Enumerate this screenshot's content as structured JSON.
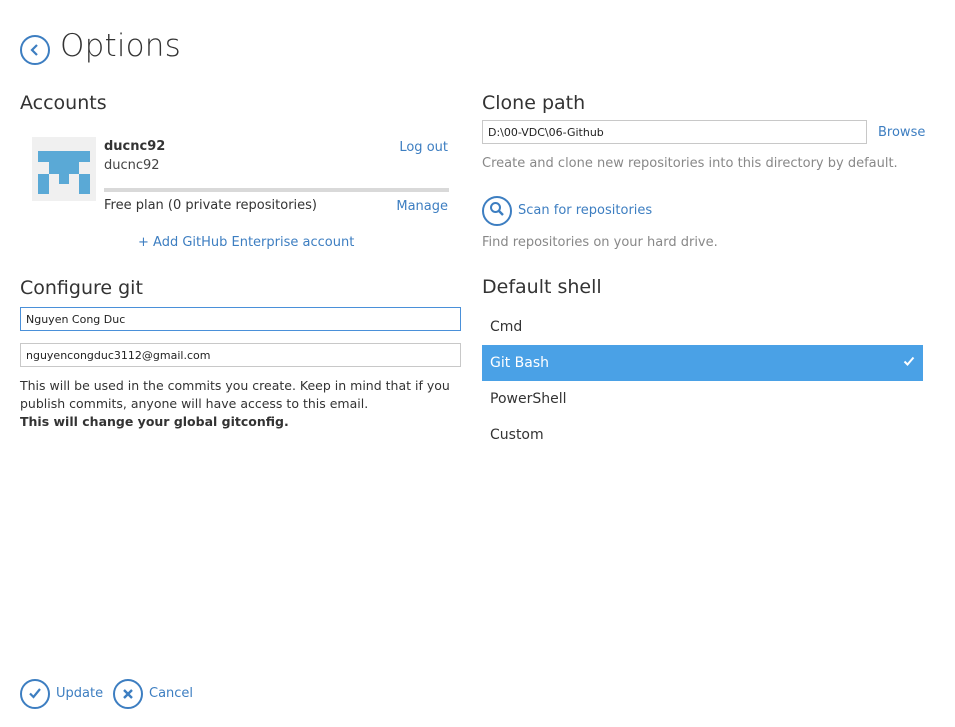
{
  "header": {
    "title": "Options",
    "back_icon": "chevron-left-icon"
  },
  "accounts": {
    "title": "Accounts",
    "name": "ducnc92",
    "login": "ducnc92",
    "logout_label": "Log out",
    "plan_text": "Free plan (0 private repositories)",
    "manage_label": "Manage",
    "add_enterprise_label": "+ Add GitHub Enterprise account",
    "avatar_color": "#5aa9d6"
  },
  "configure_git": {
    "title": "Configure git",
    "name_value": "Nguyen Cong Duc",
    "email_value": "nguyencongduc3112@gmail.com",
    "note": "This will be used in the commits you create. Keep in mind that if you publish commits, anyone will have access to this email.",
    "note_bold": "This will change your global gitconfig."
  },
  "clone_path": {
    "title": "Clone path",
    "value": "D:\\00-VDC\\06-Github",
    "browse_label": "Browse",
    "description": "Create and clone new repositories into this directory by default.",
    "scan_label": "Scan for repositories",
    "scan_icon": "search-icon",
    "scan_description": "Find repositories on your hard drive."
  },
  "default_shell": {
    "title": "Default shell",
    "options": [
      "Cmd",
      "Git Bash",
      "PowerShell",
      "Custom"
    ],
    "selected": "Git Bash",
    "selected_color": "#4aa1e6"
  },
  "footer": {
    "update_label": "Update",
    "update_icon": "check-icon",
    "cancel_label": "Cancel",
    "cancel_icon": "close-icon"
  },
  "colors": {
    "accent": "#3d7ec1"
  }
}
